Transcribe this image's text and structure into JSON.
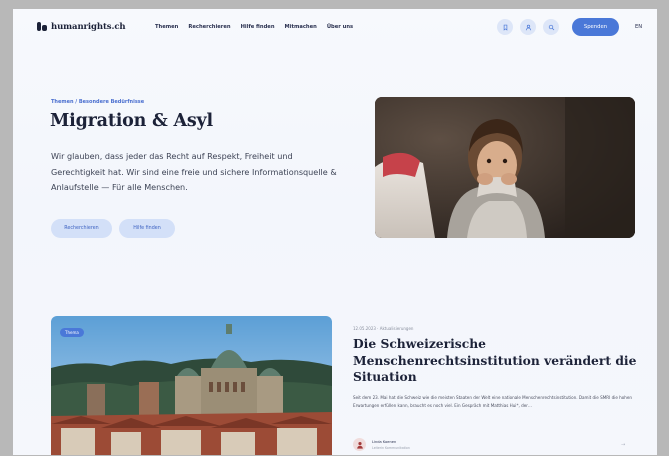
{
  "brand": {
    "name": "humanrights.ch"
  },
  "nav": {
    "items": [
      "Themen",
      "Recherchieren",
      "Hilfe finden",
      "Mitmachen",
      "Über uns"
    ]
  },
  "header": {
    "icons": [
      "bookmark-icon",
      "user-icon",
      "search-icon"
    ],
    "donate_label": "Spenden",
    "lang_label": "EN"
  },
  "hero": {
    "breadcrumb": "Themen / Besondere Bedürfnisse",
    "title": "Migration & Asyl",
    "lead": "Wir glauben, dass jeder das Recht auf Respekt, Freiheit und Gerechtigkeit hat. Wir sind eine freie und sichere Informationsquelle & Anlaufstelle — Für alle Menschen.",
    "buttons": [
      "Recherchieren",
      "Hilfe finden"
    ]
  },
  "article": {
    "tag": "Thema",
    "meta": "12.05.2023 · Aktualisierungen",
    "title": "Die Schweizerische Menschenrechtsinstitution verändert die Situation",
    "text": "Seit dem 23. Mai hat die Schweiz wie die meisten Staaten der Welt eine nationale Menschenrechtsinstitution. Damit die SMRI die hohen Erwartungen erfüllen kann, braucht es noch viel. Ein Gespräch mit Matthias Hui*, der…",
    "author_name": "Linda Koenen",
    "author_role": "Leiterin Kommunikation"
  },
  "colors": {
    "accent": "#4a78d8",
    "pill_bg": "#d3e0f8",
    "text_dark": "#1c2238"
  }
}
